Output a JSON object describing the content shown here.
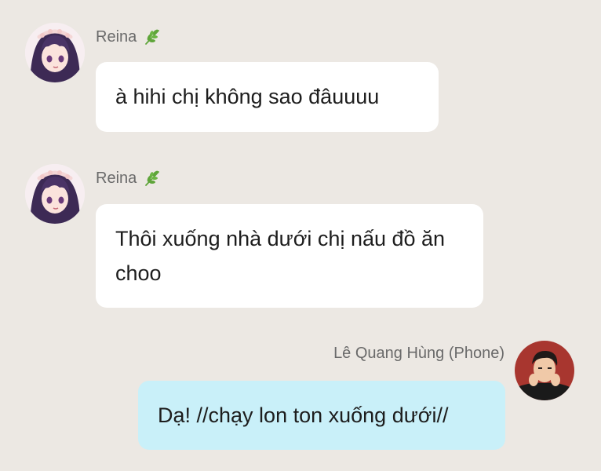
{
  "messages": [
    {
      "sender": "Reina",
      "badge_icon": "leaf-icon",
      "text": "à hihi chị không sao đâuuuu",
      "direction": "incoming"
    },
    {
      "sender": "Reina",
      "badge_icon": "leaf-icon",
      "text": "Thôi xuống nhà dưới chị nấu đồ ăn choo",
      "direction": "incoming"
    },
    {
      "sender": "Lê Quang Hùng (Phone)",
      "text": "Dạ! //chạy lon ton xuống dưới//",
      "direction": "outgoing"
    }
  ],
  "colors": {
    "background": "#ECE8E3",
    "incoming_bubble": "#FFFFFF",
    "outgoing_bubble": "#C9F0F9",
    "sender_name": "#6A6A6A",
    "message_text": "#1D1D1D",
    "leaf": "#5FA53A"
  }
}
